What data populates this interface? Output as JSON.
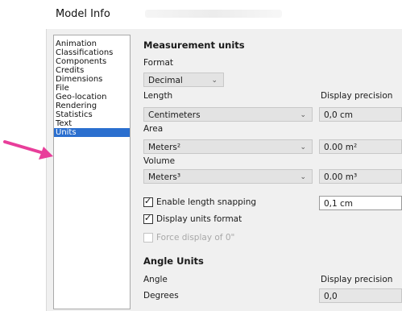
{
  "window": {
    "title": "Model Info"
  },
  "nav": {
    "items": [
      {
        "label": "Animation",
        "selected": false
      },
      {
        "label": "Classifications",
        "selected": false
      },
      {
        "label": "Components",
        "selected": false
      },
      {
        "label": "Credits",
        "selected": false
      },
      {
        "label": "Dimensions",
        "selected": false
      },
      {
        "label": "File",
        "selected": false
      },
      {
        "label": "Geo-location",
        "selected": false
      },
      {
        "label": "Rendering",
        "selected": false
      },
      {
        "label": "Statistics",
        "selected": false
      },
      {
        "label": "Text",
        "selected": false
      },
      {
        "label": "Units",
        "selected": true
      }
    ]
  },
  "colors": {
    "selection": "#2b6fcf",
    "arrow": "#e83e9a"
  },
  "measurement": {
    "header": "Measurement units",
    "format_label": "Format",
    "format_value": "Decimal",
    "length_label": "Length",
    "length_value": "Centimeters",
    "display_precision_label": "Display precision",
    "length_precision": "0,0 cm",
    "area_label": "Area",
    "area_value": "Meters²",
    "area_precision": "0.00 m²",
    "volume_label": "Volume",
    "volume_value": "Meters³",
    "volume_precision": "0.00 m³",
    "snapping_label": "Enable length snapping",
    "snapping_value": "0,1 cm",
    "display_units_label": "Display units format",
    "force_zero_label": "Force display of 0\""
  },
  "angle": {
    "header": "Angle Units",
    "angle_label": "Angle",
    "display_precision_label": "Display precision",
    "angle_value": "Degrees",
    "angle_precision": "0,0"
  }
}
